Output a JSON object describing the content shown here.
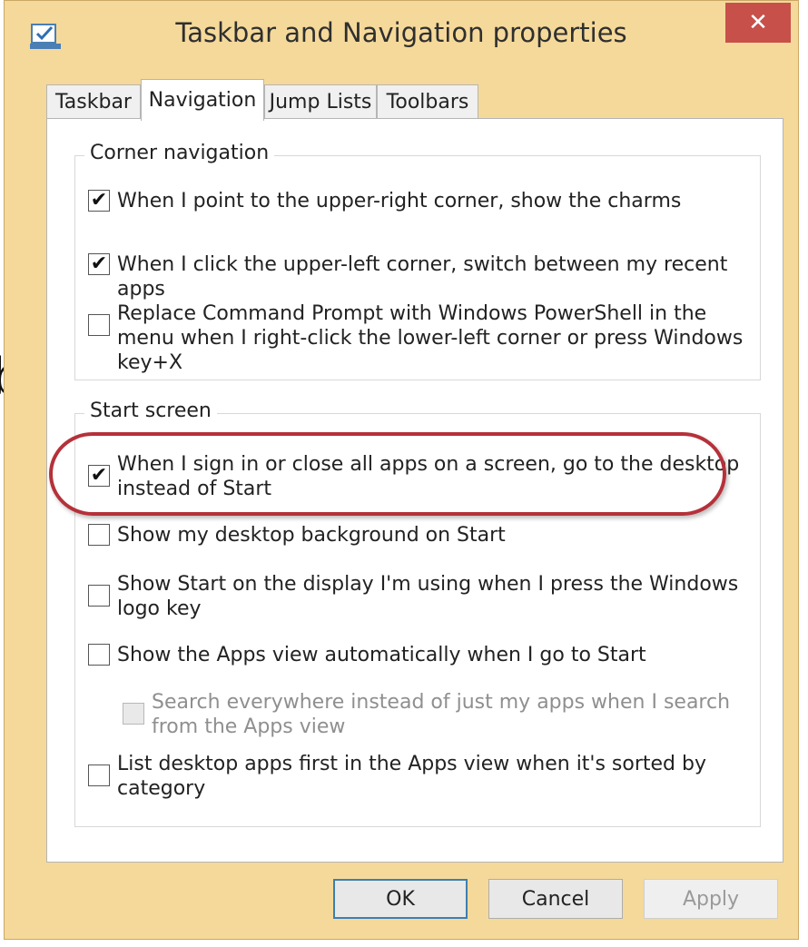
{
  "side_letter": "b",
  "window": {
    "title": "Taskbar and Navigation properties",
    "icon": "taskbar-properties-icon",
    "close_symbol": "✕"
  },
  "tabs": [
    {
      "label": "Taskbar",
      "active": false
    },
    {
      "label": "Navigation",
      "active": true
    },
    {
      "label": "Jump Lists",
      "active": false
    },
    {
      "label": "Toolbars",
      "active": false
    }
  ],
  "corner_navigation": {
    "legend": "Corner navigation",
    "options": [
      {
        "label": "When I point to the upper-right corner, show the charms",
        "checked": true
      },
      {
        "label": "When I click the upper-left corner, switch between my recent apps",
        "checked": true
      },
      {
        "label": "Replace Command Prompt with Windows PowerShell in the menu when I right-click the lower-left corner or press Windows key+X",
        "checked": false
      }
    ]
  },
  "start_screen": {
    "legend": "Start screen",
    "options": [
      {
        "label": "When I sign in or close all apps on a screen, go to the desktop instead of Start",
        "checked": true,
        "highlighted": true
      },
      {
        "label": "Show my desktop background on Start",
        "checked": false
      },
      {
        "label": "Show Start on the display I'm using when I press the Windows logo key",
        "checked": false
      },
      {
        "label": "Show the Apps view automatically when I go to Start",
        "checked": false
      },
      {
        "label": "Search everywhere instead of just my apps when I search from the Apps view",
        "checked": false,
        "disabled": true
      },
      {
        "label": "List desktop apps first in the Apps view when it's sorted by category",
        "checked": false
      }
    ]
  },
  "buttons": {
    "ok": "OK",
    "cancel": "Cancel",
    "apply": "Apply"
  },
  "colors": {
    "frame": "#f5d99a",
    "close_button": "#c7504a",
    "highlight_ring": "#b5313a",
    "default_button_border": "#3c7fb1"
  },
  "check_mark": "✔"
}
